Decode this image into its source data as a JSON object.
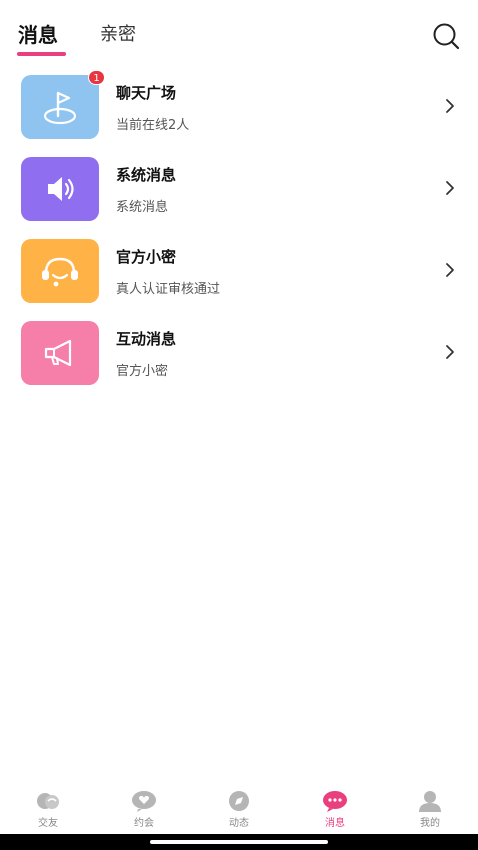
{
  "header": {
    "tabs": [
      {
        "label": "消息",
        "active": true
      },
      {
        "label": "亲密",
        "active": false
      }
    ],
    "accent": "#ea3f7f",
    "search_icon": "search-icon"
  },
  "messages": [
    {
      "title": "聊天广场",
      "subtitle": "当前在线2人",
      "icon": "flag-icon",
      "color": "#8fc3f0",
      "badge": "1"
    },
    {
      "title": "系统消息",
      "subtitle": "系统消息",
      "icon": "speaker-icon",
      "color": "#8f6ef0"
    },
    {
      "title": "官方小密",
      "subtitle": "真人认证审核通过",
      "icon": "headset-icon",
      "color": "#ffb347"
    },
    {
      "title": "互动消息",
      "subtitle": "官方小密",
      "icon": "megaphone-icon",
      "color": "#f57fa8"
    }
  ],
  "tabbar": {
    "items": [
      {
        "label": "交友",
        "icon": "friends-icon",
        "active": false
      },
      {
        "label": "约会",
        "icon": "heart-chat-icon",
        "active": false
      },
      {
        "label": "动态",
        "icon": "compass-icon",
        "active": false
      },
      {
        "label": "消息",
        "icon": "message-icon",
        "active": true
      },
      {
        "label": "我的",
        "icon": "profile-icon",
        "active": false
      }
    ]
  }
}
